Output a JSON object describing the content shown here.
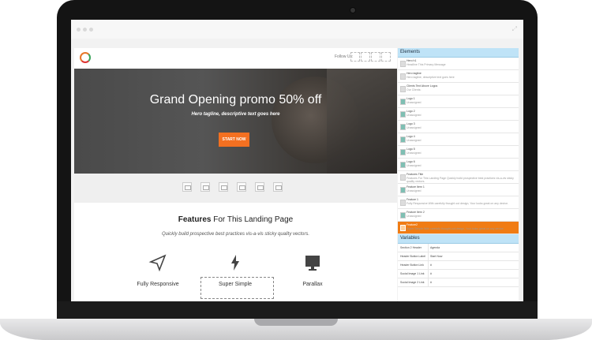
{
  "social": {
    "label": "Follow Us:"
  },
  "hero": {
    "title": "Grand Opening promo 50% off",
    "tagline": "Hero tagline, descriptive text goes here",
    "button": "START NOW"
  },
  "features": {
    "title_bold": "Features",
    "title_rest": " For This Landing Page",
    "subtitle": "Quickly build prospective best practices vis-a-vis sticky quality vectors.",
    "items": [
      {
        "label": "Fully Responsive",
        "icon": "paper-plane-icon"
      },
      {
        "label": "Super Simple",
        "icon": "lightning-icon"
      },
      {
        "label": "Parallax",
        "icon": "monitor-icon"
      }
    ]
  },
  "panel": {
    "elements_title": "Elements",
    "elements": [
      {
        "title": "Hero h1",
        "detail": "Headline This Primary Message"
      },
      {
        "title": "Hero tagline",
        "detail": "Hero tagline, descriptive text goes here"
      },
      {
        "title": "Clients Text Above Logos",
        "detail": "Our Clients:"
      },
      {
        "title": "Logo 1",
        "detail": "Unassigned"
      },
      {
        "title": "Logo 2",
        "detail": "Unassigned"
      },
      {
        "title": "Logo 3",
        "detail": "Unassigned"
      },
      {
        "title": "Logo 4",
        "detail": "Unassigned"
      },
      {
        "title": "Logo 5",
        "detail": "Unassigned"
      },
      {
        "title": "Logo 6",
        "detail": "Unassigned"
      },
      {
        "title": "Features Title",
        "detail": "Features For This Landing Page Quickly build prospective best practices vis-a-vis sticky quality vectors."
      },
      {
        "title": "Feature Item 1",
        "detail": "Unassigned"
      },
      {
        "title": "Feature 1",
        "detail": "Fully Responsive With carefully thought out design, Your looks great on any device."
      },
      {
        "title": "Feature Item 2",
        "detail": "Unassigned"
      },
      {
        "title": "Feature2",
        "detail": "Super Simple With carefully thought-out design, Your looks great on any device."
      }
    ],
    "variables_title": "Variables",
    "variables": [
      {
        "key": "Section 2 Header",
        "value": "Agenda"
      },
      {
        "key": "Header Button Label",
        "value": "Start Now"
      },
      {
        "key": "Header Button Link",
        "value": "#"
      },
      {
        "key": "Social Image 1 Link",
        "value": "#"
      },
      {
        "key": "Social Image 2 Link",
        "value": "#"
      }
    ]
  },
  "colors": {
    "accent": "#f37021",
    "panel_header": "#bfe3f7"
  }
}
